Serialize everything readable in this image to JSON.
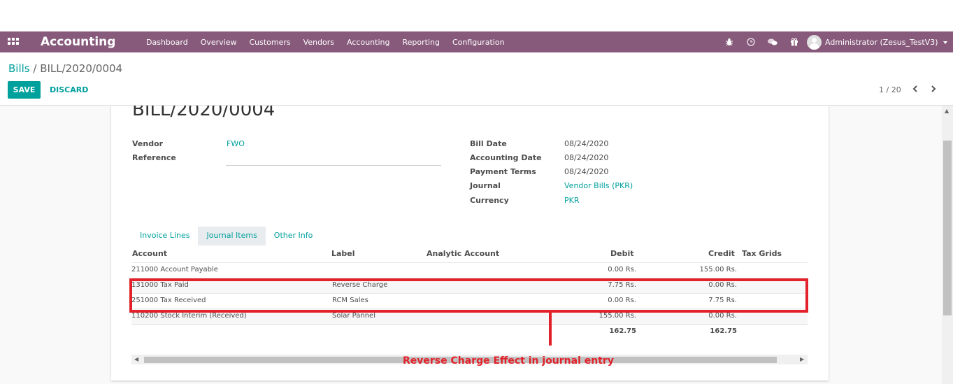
{
  "navbar": {
    "brand": "Accounting",
    "menu": [
      "Dashboard",
      "Overview",
      "Customers",
      "Vendors",
      "Accounting",
      "Reporting",
      "Configuration"
    ],
    "user": "Administrator (Zesus_TestV3)",
    "bg_color": "#875a7b"
  },
  "breadcrumb": {
    "parent": "Bills",
    "separator": " / ",
    "current": "BILL/2020/0004"
  },
  "actions": {
    "save": "SAVE",
    "discard": "DISCARD"
  },
  "pager": {
    "value": "1 / 20"
  },
  "document": {
    "title": "BILL/2020/0004",
    "left_fields": {
      "vendor_label": "Vendor",
      "vendor_value": "FWO",
      "reference_label": "Reference",
      "reference_value": ""
    },
    "right_fields": {
      "bill_date_label": "Bill Date",
      "bill_date_value": "08/24/2020",
      "accounting_date_label": "Accounting Date",
      "accounting_date_value": "08/24/2020",
      "payment_terms_label": "Payment Terms",
      "payment_terms_value": "08/24/2020",
      "journal_label": "Journal",
      "journal_value": "Vendor Bills (PKR)",
      "currency_label": "Currency",
      "currency_value": "PKR"
    }
  },
  "tabs": [
    "Invoice Lines",
    "Journal Items",
    "Other Info"
  ],
  "active_tab": "Journal Items",
  "table": {
    "headers": [
      "Account",
      "Label",
      "Analytic Account",
      "Debit",
      "Credit",
      "Tax Grids"
    ],
    "rows": [
      {
        "account": "211000 Account Payable",
        "label": "",
        "analytic": "",
        "debit": "0.00 Rs.",
        "credit": "155.00 Rs.",
        "tax": ""
      },
      {
        "account": "131000 Tax Paid",
        "label": "Reverse Charge",
        "analytic": "",
        "debit": "7.75 Rs.",
        "credit": "0.00 Rs.",
        "tax": ""
      },
      {
        "account": "251000 Tax Received",
        "label": "RCM Sales",
        "analytic": "",
        "debit": "0.00 Rs.",
        "credit": "7.75 Rs.",
        "tax": ""
      },
      {
        "account": "110200 Stock Interim (Received)",
        "label": "Solar Pannel",
        "analytic": "",
        "debit": "155.00 Rs.",
        "credit": "0.00 Rs.",
        "tax": ""
      }
    ],
    "totals": {
      "debit": "162.75",
      "credit": "162.75"
    }
  },
  "annotation": {
    "text": "Reverse Charge Effect in journal entry",
    "color": "#e2212a"
  },
  "colors": {
    "accent": "#00a09d",
    "brand": "#875a7b"
  }
}
